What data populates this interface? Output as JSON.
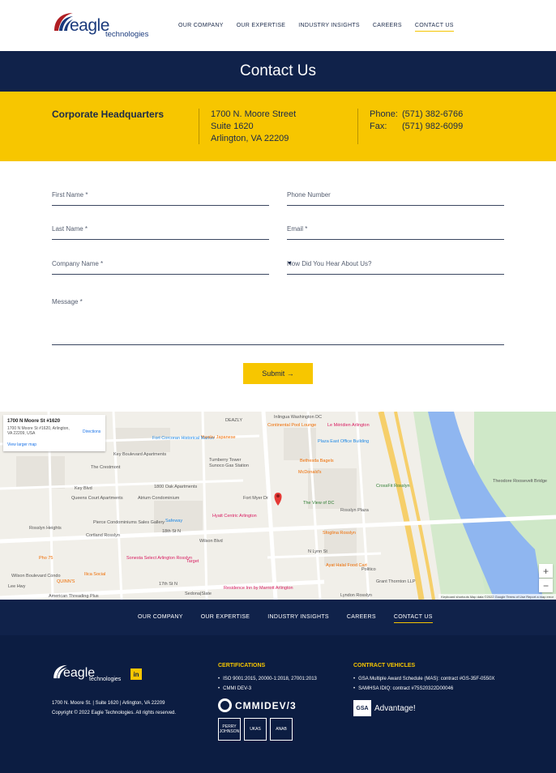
{
  "header": {
    "logo_word": "eagle",
    "logo_sub": "technologies",
    "nav": [
      "OUR COMPANY",
      "OUR EXPERTISE",
      "INDUSTRY INSIGHTS",
      "CAREERS",
      "CONTACT US"
    ]
  },
  "hero": {
    "title": "Contact Us"
  },
  "hq": {
    "title": "Corporate Headquarters",
    "address": [
      "1700 N. Moore Street",
      "Suite 1620",
      "Arlington, VA 22209"
    ],
    "phone_label": "Phone:",
    "phone": "(571) 382-6766",
    "fax_label": "Fax:",
    "fax": "(571) 982-6099"
  },
  "form": {
    "first_name": "First Name *",
    "phone_number": "Phone Number",
    "last_name": "Last Name *",
    "email": "Email *",
    "company_name": "Company Name *",
    "how_hear": "How Did You Hear About Us?",
    "message": "Message *",
    "submit": "Submit →"
  },
  "map": {
    "card_title": "1700 N Moore St #1620",
    "card_address": "1700 N Moore St #1620, Arlington, VA 22209, USA",
    "card_link": "View larger map",
    "directions": "Directions",
    "labels": [
      "Key Boulevard Apartments",
      "Fort Corcoran Historical Marker",
      "Tumberry Tower",
      "Sunoco Gas Station",
      "The Crestmont",
      "Key Blvd",
      "Queens Court Apartments",
      "1800 Oak Apartments",
      "Atrium Condominium",
      "Pierce Condominiums Sales Gallery",
      "Rosslyn Heights",
      "Cortland Rosslyn",
      "Safeway",
      "Hyatt Centric Arlington",
      "Wilson Blvd",
      "Target",
      "Sonesta Select Arlington Rosslyn",
      "Pho 75",
      "Ilica Social",
      "QUINN'S",
      "Residence Inn by Marriott Arlington",
      "Continental Pool Lounge",
      "Le Méridien Arlington",
      "Plaza East Office Building",
      "Bethesda Bagels",
      "McDonald's",
      "The View of DC",
      "CrossFit Rosslyn",
      "Rosslyn Plaza",
      "Sfoglina Rosslyn",
      "Ayat Halal Food Cart",
      "Politico",
      "Grant Thornton LLP",
      "Theodore Roosevelt Bridge",
      "Fort Myer Dr",
      "N Lynn St",
      "Yuraku Japanese",
      "DEAZLY",
      "Inlingua Washington DC",
      "Lee Hwy",
      "American Threading Plus",
      "Lyndon Rosslyn",
      "Sedona|Slate",
      "18th St N",
      "17th St N",
      "Wilson Boulevard Condo"
    ],
    "footer": "Keyboard shortcuts   Map data ©2022 Google   Terms of Use   Report a map error"
  },
  "footer_nav": [
    "OUR COMPANY",
    "OUR EXPERTISE",
    "INDUSTRY INSIGHTS",
    "CAREERS",
    "CONTACT US"
  ],
  "footer": {
    "logo_word": "eagle",
    "logo_sub": "technologies",
    "linkedin": "in",
    "address": "1700 N. Moore St. | Suite 1620 | Arlington, VA 22209",
    "copyright": "Copyright © 2022 Eagle Technologies. All rights reserved.",
    "cert_title": "CERTIFICATIONS",
    "certs": [
      "ISO 9001:2015, 20000-1:2018, 27001:2013",
      "CMMI DEV-3"
    ],
    "cmmi": "CMMIDEV/3",
    "badges": [
      "PERRY JOHNSON",
      "UKAS",
      "ANAB"
    ],
    "contract_title": "CONTRACT VEHICLES",
    "contracts": [
      "GSA Multiple Award Schedule (MAS): contract #GS-35F-0550X",
      "SAMHSA IDIQ: contract #75S20322D00046"
    ],
    "gsa": "GSA",
    "advantage": "Advantage!"
  }
}
